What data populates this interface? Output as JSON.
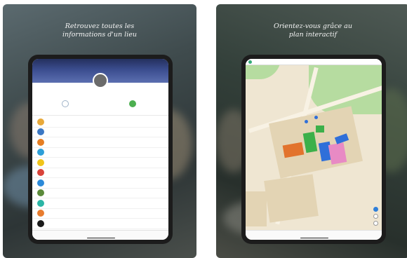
{
  "left": {
    "caption_line1": "Retrouvez toutes les",
    "caption_line2": "informations d'un lieu",
    "banner_title": "",
    "place_name": "",
    "tab_labels": [
      "",
      ""
    ],
    "list_items": [
      {
        "l1": "",
        "l2": "",
        "color": "#e8a93a"
      },
      {
        "l1": "",
        "l2": "",
        "color": "#3b78c4"
      },
      {
        "l1": "",
        "l2": "",
        "color": "#e67e22"
      },
      {
        "l1": "",
        "l2": "",
        "color": "#2e9fd8"
      },
      {
        "l1": "",
        "l2": "",
        "color": "#f0c419"
      },
      {
        "l1": "",
        "l2": "",
        "color": "#d9433a"
      },
      {
        "l1": "",
        "l2": "",
        "color": "#2c8ad9"
      },
      {
        "l1": "",
        "l2": "",
        "color": "#5b8a3a"
      },
      {
        "l1": "",
        "l2": "",
        "color": "#2bb5a5"
      },
      {
        "l1": "",
        "l2": "",
        "color": "#e87c2e"
      },
      {
        "l1": "",
        "l2": "",
        "color": "#1a1a1a"
      },
      {
        "l1": "",
        "l2": "",
        "color": "#5f8fd1"
      }
    ],
    "bottom_tabs": [
      "",
      "",
      ""
    ]
  },
  "right": {
    "caption_line1": "Orientez-vous grâce au",
    "caption_line2": "plan interactif",
    "top_menu": [
      "",
      "",
      "",
      "",
      ""
    ],
    "bottom_tabs": [
      "",
      "",
      ""
    ]
  }
}
